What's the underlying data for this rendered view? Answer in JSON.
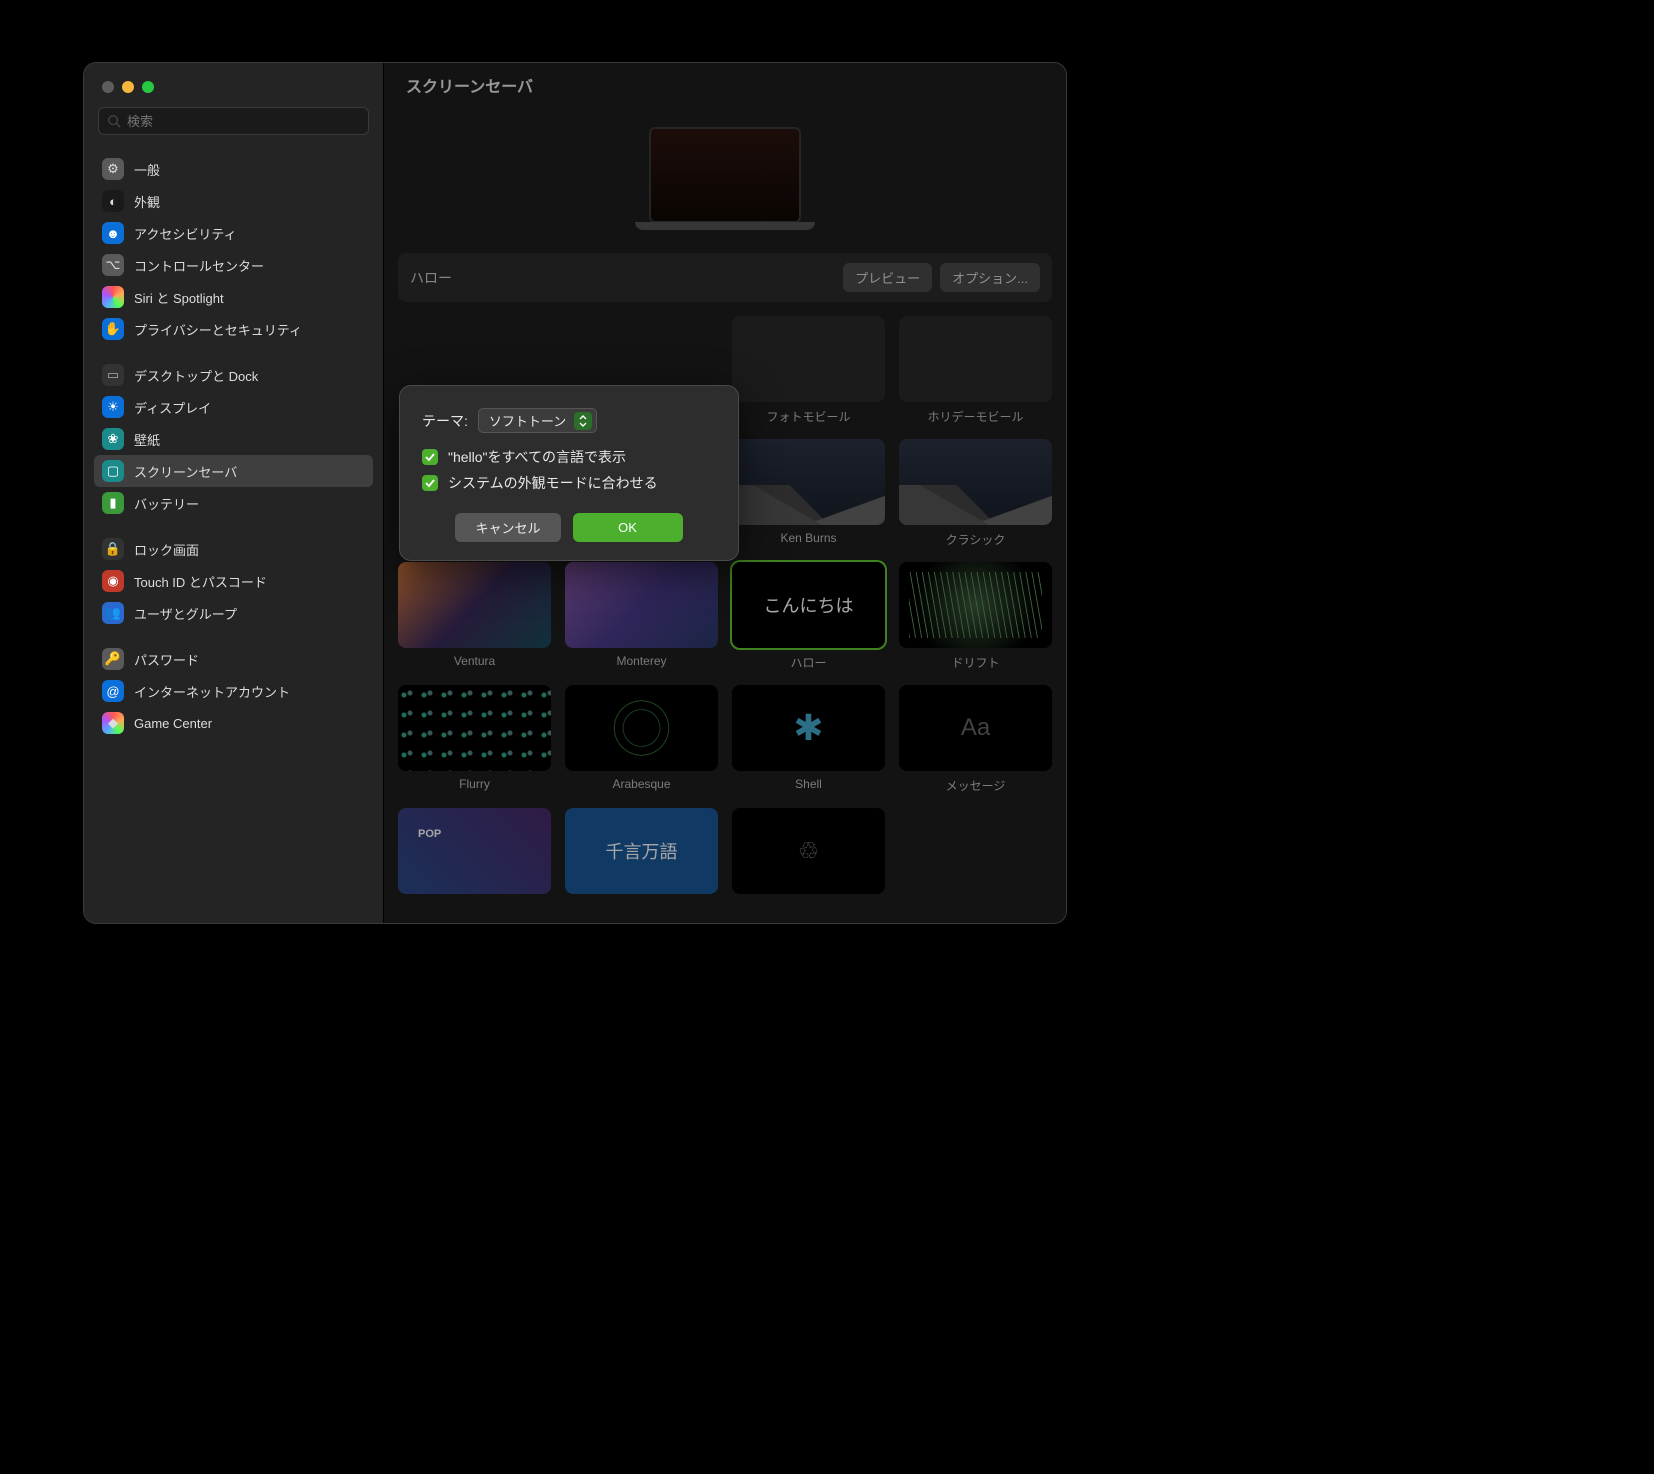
{
  "title": "スクリーンセーバ",
  "search_placeholder": "検索",
  "sidebar": {
    "items": [
      {
        "label": "一般",
        "icon": "⚙",
        "cls": "ic-gray"
      },
      {
        "label": "外観",
        "icon": "◐",
        "cls": "ic-black"
      },
      {
        "label": "アクセシビリティ",
        "icon": "☻",
        "cls": "ic-blue"
      },
      {
        "label": "コントロールセンター",
        "icon": "⌥",
        "cls": "ic-gray"
      },
      {
        "label": "Siri と Spotlight",
        "icon": "",
        "cls": "ic-rainbow"
      },
      {
        "label": "プライバシーとセキュリティ",
        "icon": "✋",
        "cls": "ic-blue"
      },
      {
        "sep": true
      },
      {
        "label": "デスクトップと Dock",
        "icon": "▭",
        "cls": "ic-dark"
      },
      {
        "label": "ディスプレイ",
        "icon": "☀",
        "cls": "ic-blue"
      },
      {
        "label": "壁紙",
        "icon": "❀",
        "cls": "ic-teal"
      },
      {
        "label": "スクリーンセーバ",
        "icon": "▢",
        "cls": "ic-teal",
        "selected": true
      },
      {
        "label": "バッテリー",
        "icon": "▮",
        "cls": "ic-green"
      },
      {
        "sep": true
      },
      {
        "label": "ロック画面",
        "icon": "🔒",
        "cls": "ic-dark"
      },
      {
        "label": "Touch ID とパスコード",
        "icon": "◉",
        "cls": "ic-red"
      },
      {
        "label": "ユーザとグループ",
        "icon": "👥",
        "cls": "ic-bluesq"
      },
      {
        "sep": true
      },
      {
        "label": "パスワード",
        "icon": "🔑",
        "cls": "ic-gray"
      },
      {
        "label": "インターネットアカウント",
        "icon": "@",
        "cls": "ic-blue"
      },
      {
        "label": "Game Center",
        "icon": "◆",
        "cls": "ic-rainbow"
      }
    ]
  },
  "selected_name": "ハロー",
  "preview_button": "プレビュー",
  "options_button": "オプション...",
  "grid": [
    {
      "label": "フォトモビール",
      "art": "t-photomobile"
    },
    {
      "label": "ホリデーモビール",
      "art": "t-holidaymobile"
    },
    {
      "label": "Ken Burns",
      "art": "t-mountain"
    },
    {
      "label": "クラシック",
      "art": "t-mountain"
    },
    {
      "label": "Ventura",
      "art": "t-ventura"
    },
    {
      "label": "Monterey",
      "art": "t-monterey"
    },
    {
      "label": "ハロー",
      "art": "t-hello",
      "selected": true,
      "text": "こんにちは"
    },
    {
      "label": "ドリフト",
      "art": "t-drift"
    },
    {
      "label": "Flurry",
      "art": "t-flurry"
    },
    {
      "label": "Arabesque",
      "art": "t-arab"
    },
    {
      "label": "Shell",
      "art": "t-shell"
    },
    {
      "label": "メッセージ",
      "art": "t-msg",
      "text": "Aa"
    },
    {
      "label": "",
      "art": "t-itunes"
    },
    {
      "label": "",
      "art": "t-word",
      "text": "千言万語"
    },
    {
      "label": "",
      "art": "t-recycle",
      "text": "♲"
    }
  ],
  "sheet": {
    "theme_label": "テーマ:",
    "theme_value": "ソフトトーン",
    "check1": "\"hello\"をすべての言語で表示",
    "check2": "システムの外観モードに合わせる",
    "cancel": "キャンセル",
    "ok": "OK"
  }
}
